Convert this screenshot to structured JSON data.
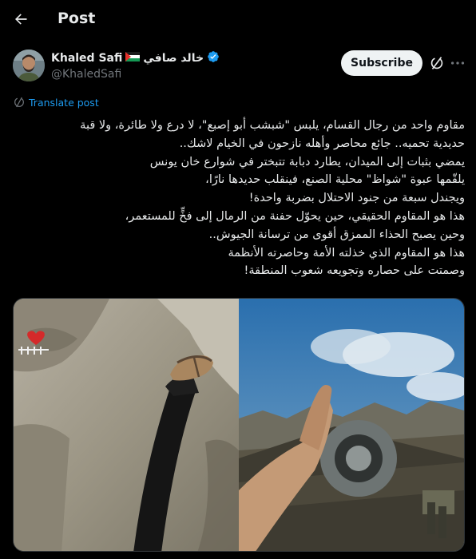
{
  "header": {
    "title": "Post",
    "back_icon": "arrow-left-icon"
  },
  "author": {
    "display_name": "Khaled Safi",
    "arabic_name": "خالد صافي",
    "handle": "@KhaledSafi",
    "flag_icon": "palestine-flag-icon",
    "verified_icon": "verified-badge-icon"
  },
  "actions": {
    "subscribe_label": "Subscribe",
    "grok_icon": "grok-icon",
    "more_icon": "more-options-icon"
  },
  "translate": {
    "label": "Translate post",
    "icon": "translate-icon"
  },
  "post": {
    "lines": [
      "مقاوم واحد من رجال القسام، يلبس \"شبشب أبو إصبع\"، لا درع ولا طائرة، ولا قبة",
      "حديدية تحميه.. جائع محاصر وأهله نازحون في الخيام لاشك..",
      "يمضي بثبات إلى الميدان، يطارد دبابة تتبختر في شوارع خان يونس",
      "يلقّمها عبوة \"شواظ\" محلية الصنع، فينقلب حديدها نارًا،",
      "ويجندل سبعة من جنود الاحتلال بضربة واحدة!",
      "هذا هو المقاوم الحقيقي، حين يحوّل حفنة من الرمال إلى فخٍّ للمستعمر،",
      "وحين يصبح الحذاء الممزق أقوى من ترسانة الجيوش..",
      "هذا هو المقاوم الذي خذلته الأمة وحاصرته الأنظمة",
      "وصمتت على حصاره وتجويعه شعوب المنطقة!"
    ]
  },
  "media": {
    "left_image": "sandal-foot-on-sand-photo",
    "right_image": "hand-placing-device-on-tank-photo"
  }
}
